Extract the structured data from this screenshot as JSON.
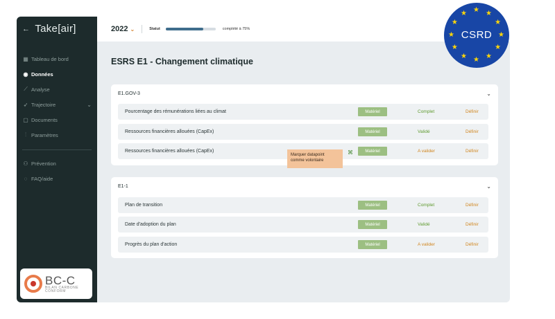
{
  "sidebar": {
    "brand": "Take[air]",
    "back_icon": "arrow-left-icon",
    "items": [
      {
        "label": "Tableau de bord",
        "icon": "dashboard-icon"
      },
      {
        "label": "Données",
        "icon": "data-icon"
      },
      {
        "label": "Analyse",
        "icon": "chart-icon"
      },
      {
        "label": "Trajectoire",
        "icon": "rocket-icon"
      },
      {
        "label": "Documents",
        "icon": "document-icon"
      },
      {
        "label": "Paramètres",
        "icon": "sliders-icon"
      },
      {
        "label": "Prévention",
        "icon": "people-icon"
      },
      {
        "label": "FAQ/aide",
        "icon": "chat-icon"
      }
    ],
    "active_item": "Données"
  },
  "topbar": {
    "year": "2022",
    "statut_label": "Statut",
    "progress_fraction": 0.75,
    "progress_text": "complété à 75%"
  },
  "page": {
    "title": "ESRS E1 - Changement climatique"
  },
  "sections": [
    {
      "title": "E1.GOV-3",
      "rows": [
        {
          "label": "Pourcentage des rémunérations liées au climat",
          "tag": "Matériel",
          "status": "Complet",
          "action": "Définir"
        },
        {
          "label": "Ressources financières allouées (CapEx)",
          "tag": "Matériel",
          "status": "Validé",
          "action": "Définir"
        },
        {
          "label": "Ressources financières allouées (CapEx)",
          "tag": "Matériel",
          "status": "A valider",
          "action": "Définir"
        }
      ]
    },
    {
      "title": "E1-1",
      "rows": [
        {
          "label": "Plan de transition",
          "tag": "Matériel",
          "status": "Complet",
          "action": "Définir"
        },
        {
          "label": "Date d'adoption du plan",
          "tag": "Matériel",
          "status": "Validé",
          "action": "Définir"
        },
        {
          "label": "Progrès du plan d'action",
          "tag": "Matériel",
          "status": "A valider",
          "action": "Définir"
        }
      ]
    }
  ],
  "tooltip": {
    "text": "Marquer datapoint comme volontaire"
  },
  "badges": {
    "csrd": "CSRD",
    "bcc_big": "BC-C",
    "bcc_line1": "BILAN CARBONE",
    "bcc_line2": "CONFORM"
  },
  "colors": {
    "sidebar_bg": "#1d2b2c",
    "accent_orange": "#d0851e",
    "green": "#5f9a2f",
    "tag_green": "#9cbf82",
    "csrd_blue": "#1846a6",
    "star_yellow": "#ffd60a"
  }
}
